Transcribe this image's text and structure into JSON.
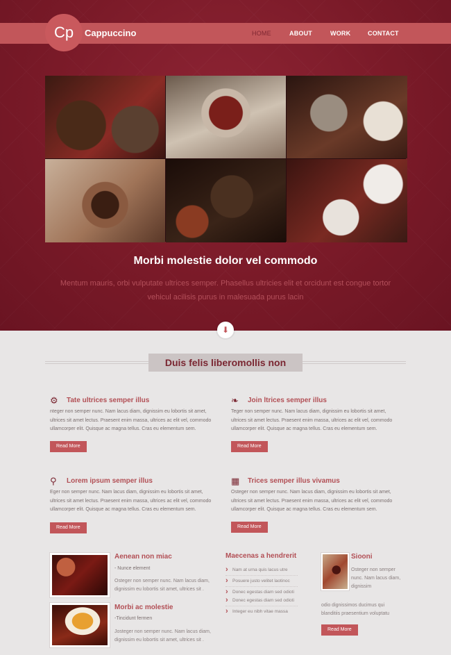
{
  "header": {
    "logo_text": "Cp",
    "brand": "Cappuccino",
    "nav": [
      {
        "label": "HOME",
        "active": true
      },
      {
        "label": "ABOUT",
        "active": false
      },
      {
        "label": "WORK",
        "active": false
      },
      {
        "label": "CONTACT",
        "active": false
      }
    ]
  },
  "hero": {
    "title": "Morbi molestie dolor vel commodo",
    "subtitle": "Mentum mauris, orbi vulputate ultrices semper. Phasellus ultricies elit et orcidunt est congue tortor vehicul acilisis purus in malesuada purus lacin",
    "down_icon": "arrow-down-icon"
  },
  "section": {
    "title": "Duis felis liberomollis non"
  },
  "features": [
    {
      "icon": "gear-icon",
      "title": "Tate ultrices semper illus",
      "text": "nteger non semper nunc. Nam lacus diam, dignissim eu lobortis sit amet, ultrices sit amet lectus. Praesent enim massa, ultrices ac elit vel, commodo ullamcorper elit. Quisque ac magna tellus. Cras eu elementum sem.",
      "button": "Read More"
    },
    {
      "icon": "leaf-icon",
      "title": "Join ltrices semper illus",
      "text": "Teger non semper nunc. Nam lacus diam, dignissim eu lobortis sit amet, ultrices sit amet lectus. Praesent enim massa, ultrices ac elit vel, commodo ullamcorper elit. Quisque ac magna tellus. Cras eu elementum sem.",
      "button": "Read More"
    },
    {
      "icon": "trophy-icon",
      "title": "Lorem ipsum semper illus",
      "text": "Eger non semper nunc. Nam lacus diam, dignissim eu lobortis sit amet, ultrices sit amet lectus. Praesent enim massa, ultrices ac elit vel, commodo ullamcorper elit. Quisque ac magna tellus. Cras eu elementum sem.",
      "button": "Read More"
    },
    {
      "icon": "gift-icon",
      "title": "Trices semper illus vivamus",
      "text": "Osteger non semper nunc. Nam lacus diam, dignissim eu lobortis sit amet, ultrices sit amet lectus. Praesent enim massa, ultrices ac elit vel, commodo ullamcorper elit. Quisque ac magna tellus. Cras eu elementum sem.",
      "button": "Read More"
    }
  ],
  "posts": [
    {
      "title": "Aenean non miac",
      "meta": "- Nunce element",
      "text": "Osteger non semper nunc. Nam lacus diam, dignissim eu lobortis sit amet, ultrices sit ."
    },
    {
      "title": "Morbi ac molestie",
      "meta": "-Tincidunt fermen",
      "text": "Josteger non semper nunc. Nam lacus diam, dignissim eu lobortis sit amet, ultrices sit ."
    }
  ],
  "links": {
    "title": "Maecenas a hendrerit",
    "items": [
      "Nam at urna quis lacus utre",
      "Posuere justo velitet laotinoc",
      "Donec egestas diam sed odioti",
      "Donec egestas diam sed odioti",
      "Integer eu nibh vitae massa"
    ]
  },
  "aside": {
    "title": "Siooni",
    "text": "Osteger non semper nunc. Nam lacus diam, dignissim",
    "text2": "odio dignissimos ducimus qui blanditiis praesentium voluptatu",
    "button": "Read More"
  }
}
